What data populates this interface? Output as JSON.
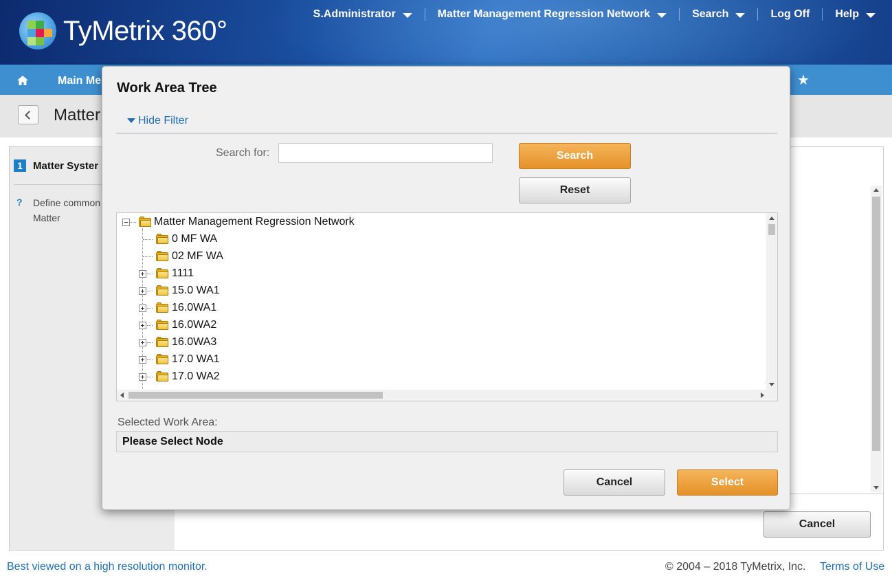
{
  "header": {
    "logo_text": "TyMetrix 360°",
    "nav": [
      {
        "label": "S.Administrator",
        "has_caret": true
      },
      {
        "label": "Matter Management Regression Network",
        "has_caret": true
      },
      {
        "label": "Search",
        "has_caret": true
      },
      {
        "label": "Log Off",
        "has_caret": false
      },
      {
        "label": "Help",
        "has_caret": true
      }
    ]
  },
  "menubar": {
    "home_icon": "home-icon",
    "main_menu_label": "Main Me",
    "favorites_icon": "star-icon"
  },
  "page": {
    "title": "Matter"
  },
  "left_panel": {
    "step_number": "1",
    "step_label": "Matter Syster",
    "help_symbol": "?",
    "help_text": "Define common Matter"
  },
  "background_actions": {
    "cancel_label": "Cancel"
  },
  "footer": {
    "left_text": "Best viewed on a high resolution monitor.",
    "copyright": "© 2004 – 2018 TyMetrix, Inc.",
    "terms_label": "Terms of Use"
  },
  "modal": {
    "title": "Work Area Tree",
    "hide_filter_label": "Hide Filter",
    "search_label": "Search for:",
    "search_value": "",
    "search_placeholder": "",
    "search_button": "Search",
    "reset_button": "Reset",
    "tree": {
      "root": {
        "label": "Matter Management Regression Network",
        "expanded": true
      },
      "children": [
        {
          "label": "0 MF WA",
          "expandable": false
        },
        {
          "label": "02 MF WA",
          "expandable": false
        },
        {
          "label": "1111",
          "expandable": true
        },
        {
          "label": "15.0 WA1",
          "expandable": true
        },
        {
          "label": "16.0WA1",
          "expandable": true
        },
        {
          "label": "16.0WA2",
          "expandable": true
        },
        {
          "label": "16.0WA3",
          "expandable": true
        },
        {
          "label": "17.0 WA1",
          "expandable": true
        },
        {
          "label": "17.0 WA2",
          "expandable": true
        }
      ]
    },
    "selected_label": "Selected Work Area:",
    "selected_value": "Please Select Node",
    "cancel_button": "Cancel",
    "select_button": "Select"
  },
  "colors": {
    "accent_orange": "#e4922a",
    "menubar_blue": "#3d8fd0",
    "link_blue": "#1f6fb4",
    "step_blue": "#1f7fc4"
  }
}
